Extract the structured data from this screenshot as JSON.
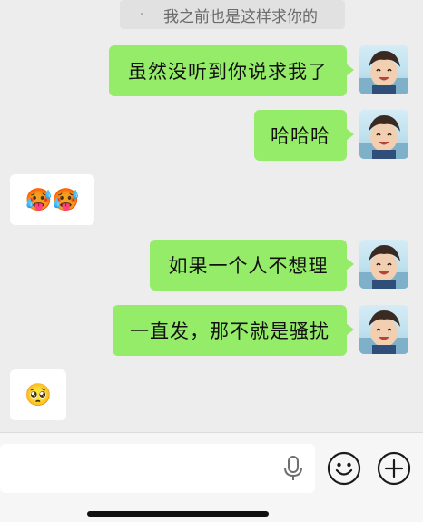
{
  "quoted_message": {
    "text": "我之前也是这样求你的",
    "marker": "·"
  },
  "messages": [
    {
      "side": "right",
      "text": "虽然没听到你说求我了"
    },
    {
      "side": "right",
      "text": "哈哈哈"
    },
    {
      "side": "left",
      "emoji": "🥵🥵"
    },
    {
      "side": "right",
      "text": "如果一个人不想理"
    },
    {
      "side": "right",
      "text": "一直发，那不就是骚扰"
    },
    {
      "side": "left",
      "emoji": "🥺"
    }
  ],
  "input_bar": {
    "icons": [
      "microphone-icon",
      "emoji-face-icon",
      "plus-icon"
    ]
  },
  "colors": {
    "bubble_green": "#95ec69",
    "bubble_white": "#ffffff",
    "background": "#ededed"
  }
}
